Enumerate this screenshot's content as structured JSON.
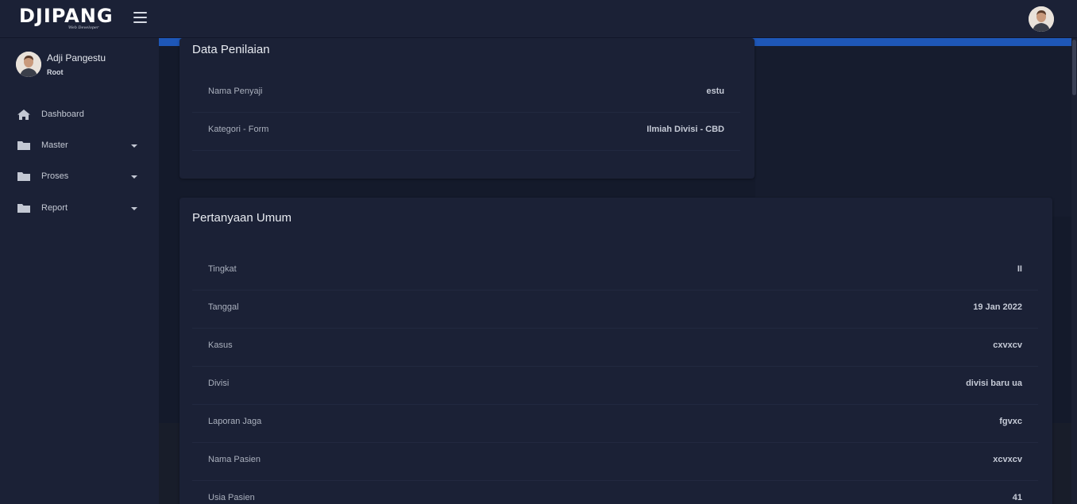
{
  "brand": {
    "logo": "DJIPANG",
    "tagline": "Web Developer"
  },
  "user": {
    "name": "Adji Pangestu",
    "role": "Root"
  },
  "sidebar": {
    "items": [
      {
        "label": "Dashboard",
        "icon": "home-icon",
        "has_submenu": false
      },
      {
        "label": "Master",
        "icon": "folder-icon",
        "has_submenu": true
      },
      {
        "label": "Proses",
        "icon": "folder-icon",
        "has_submenu": true
      },
      {
        "label": "Report",
        "icon": "folder-icon",
        "has_submenu": true
      }
    ]
  },
  "data_penilaian": {
    "title": "Data Penilaian",
    "rows": [
      {
        "label": "Nama Penyaji",
        "value": "estu"
      },
      {
        "label": "Kategori - Form",
        "value": "Ilmiah Divisi - CBD"
      }
    ]
  },
  "pertanyaan_umum": {
    "title": "Pertanyaan Umum",
    "rows": [
      {
        "label": "Tingkat",
        "value": "II"
      },
      {
        "label": "Tanggal",
        "value": "19 Jan 2022"
      },
      {
        "label": "Kasus",
        "value": "cxvxcv"
      },
      {
        "label": "Divisi",
        "value": "divisi baru ua"
      },
      {
        "label": "Laporan Jaga",
        "value": "fgvxc"
      },
      {
        "label": "Nama Pasien",
        "value": "xcvxcv"
      },
      {
        "label": "Usia Pasien",
        "value": "41"
      }
    ]
  },
  "colors": {
    "accent": "#1e57b7",
    "background": "#141a2b",
    "card": "#1b2136"
  }
}
